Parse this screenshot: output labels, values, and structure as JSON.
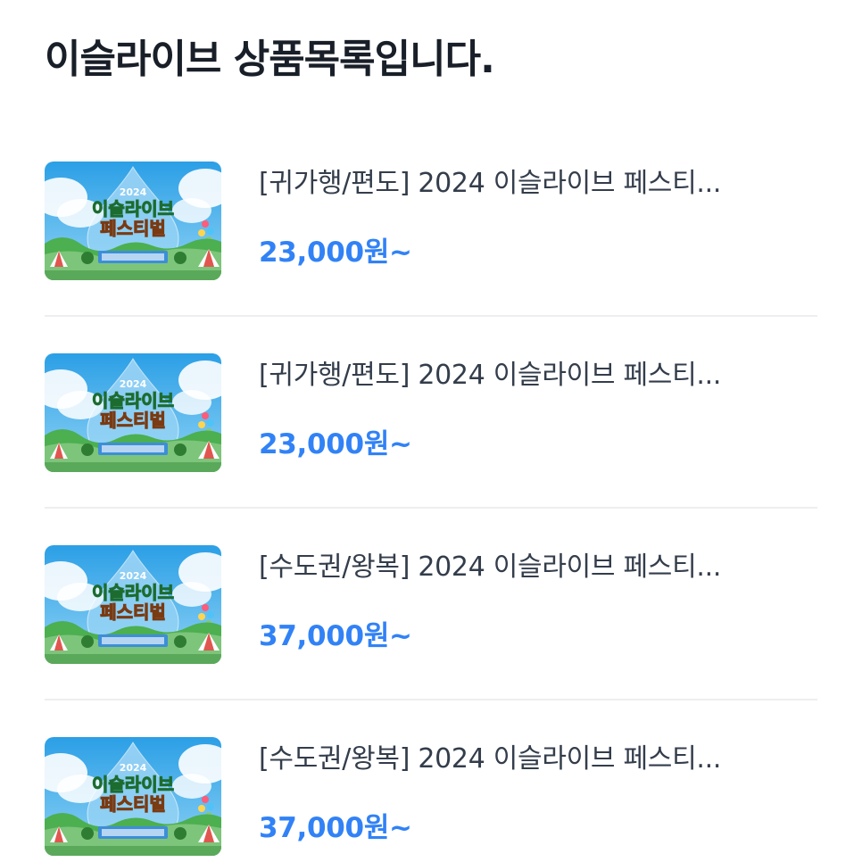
{
  "page": {
    "title": "이슬라이브 상품목록입니다."
  },
  "thumbnail": {
    "year": "2024",
    "line1": "이슬라이브",
    "line2": "페스티벌"
  },
  "products": [
    {
      "name": "[귀가행/편도] 2024 이슬라이브 페스티...",
      "price": "23,000원~"
    },
    {
      "name": "[귀가행/편도] 2024 이슬라이브 페스티...",
      "price": "23,000원~"
    },
    {
      "name": "[수도권/왕복] 2024 이슬라이브 페스티...",
      "price": "37,000원~"
    },
    {
      "name": "[수도권/왕복] 2024 이슬라이브 페스티...",
      "price": "37,000원~"
    }
  ],
  "colors": {
    "accent": "#3182f6",
    "title": "#191f28",
    "text": "#333d4b",
    "divider": "#eceef1"
  }
}
